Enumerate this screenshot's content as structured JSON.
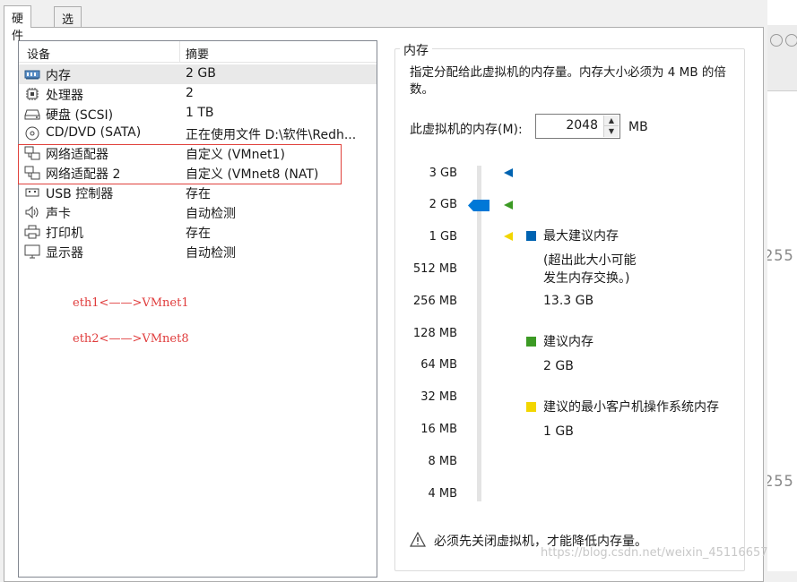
{
  "tabs": [
    {
      "label": "硬件",
      "active": true
    },
    {
      "label": "选项",
      "active": false
    }
  ],
  "device_table": {
    "headers": {
      "device": "设备",
      "summary": "摘要"
    },
    "rows": [
      {
        "icon": "memory-icon",
        "name": "内存",
        "summary": "2 GB",
        "selected": true
      },
      {
        "icon": "processor-icon",
        "name": "处理器",
        "summary": "2"
      },
      {
        "icon": "hard-disk-icon",
        "name": "硬盘 (SCSI)",
        "summary": "1 TB"
      },
      {
        "icon": "cd-dvd-icon",
        "name": "CD/DVD (SATA)",
        "summary": "正在使用文件 D:\\软件\\Redh..."
      },
      {
        "icon": "network-adapter-icon",
        "name": "网络适配器",
        "summary": "自定义 (VMnet1)"
      },
      {
        "icon": "network-adapter-icon",
        "name": "网络适配器 2",
        "summary": "自定义 (VMnet8 (NAT)"
      },
      {
        "icon": "usb-icon",
        "name": "USB 控制器",
        "summary": "存在"
      },
      {
        "icon": "sound-card-icon",
        "name": "声卡",
        "summary": "自动检测"
      },
      {
        "icon": "printer-icon",
        "name": "打印机",
        "summary": "存在"
      },
      {
        "icon": "display-icon",
        "name": "显示器",
        "summary": "自动检测"
      }
    ]
  },
  "annotations": [
    "eth1<——>VMnet1",
    "eth2<——>VMnet8"
  ],
  "memory": {
    "group_title": "内存",
    "description": "指定分配给此虚拟机的内存量。内存大小必须为 4 MB 的倍数。",
    "field_label": "此虚拟机的内存(M):",
    "value": "2048",
    "unit": "MB",
    "scale": [
      "3 GB",
      "2 GB",
      "1 GB",
      "512 MB",
      "256 MB",
      "128 MB",
      "64 MB",
      "32 MB",
      "16 MB",
      "8 MB",
      "4 MB"
    ],
    "legend": {
      "max": {
        "title": "最大建议内存",
        "note": "(超出此大小可能\n发生内存交换。)",
        "value": "13.3 GB",
        "color": "#0063b1"
      },
      "recommended": {
        "title": "建议内存",
        "value": "2 GB",
        "color": "#3c9a24"
      },
      "min_guest": {
        "title": "建议的最小客户机操作系统内存",
        "value": "1 GB",
        "color": "#f2d600"
      }
    },
    "slider_color": "#0078d7",
    "warning": "必须先关闭虚拟机，才能降低内存量。"
  },
  "background": {
    "number_text": "255"
  },
  "watermark": "https://blog.csdn.net/weixin_45116657"
}
